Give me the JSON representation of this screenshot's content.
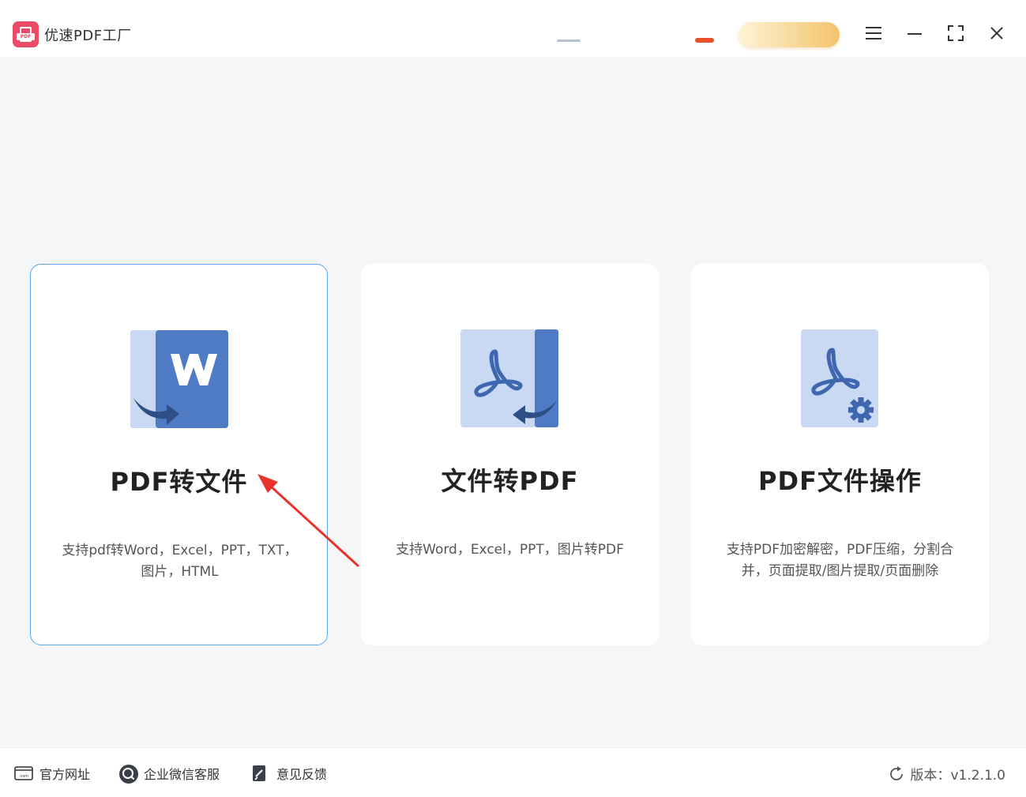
{
  "window": {
    "title": "优速PDF工厂",
    "logo_text": "PDF"
  },
  "colors": {
    "brand": "#ea4b67",
    "active_border": "#5aa9f0",
    "icon_dark": "#4f7bc4",
    "icon_light": "#c9d9f4",
    "arrow_red": "#e8322a"
  },
  "cards": [
    {
      "title": "PDF转文件",
      "desc_line1": "支持pdf转Word，Excel，PPT，TXT，",
      "desc_line2": "图片，HTML",
      "icon": "word-convert-icon",
      "selected": true
    },
    {
      "title": "文件转PDF",
      "desc_line1": "支持Word，Excel，PPT，图片转PDF",
      "desc_line2": "",
      "icon": "pdf-convert-icon",
      "selected": false
    },
    {
      "title": "PDF文件操作",
      "desc_line1": "支持PDF加密解密，PDF压缩，分割合",
      "desc_line2": "并，页面提取/图片提取/页面删除",
      "icon": "pdf-settings-icon",
      "selected": false
    }
  ],
  "statusbar": {
    "website": "官方网址",
    "wechat": "企业微信客服",
    "feedback": "意见反馈",
    "version": "版本：v1.2.1.0"
  }
}
